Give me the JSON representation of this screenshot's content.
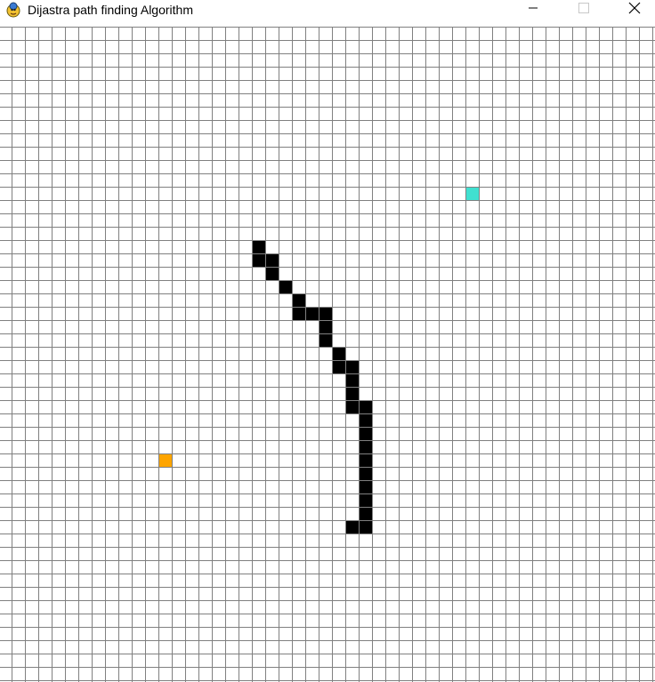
{
  "window": {
    "title": "Dijastra path finding Algorithm",
    "icon": "pygame-snake-icon",
    "controls": [
      "minimize-icon",
      "maximize-icon",
      "close-icon"
    ]
  },
  "grid": {
    "cols": 49,
    "rows": 49,
    "empty_color": "#ffffff",
    "line_color": "#808080",
    "start": {
      "col": 12,
      "row": 32,
      "color": "#ffa500"
    },
    "end": {
      "col": 35,
      "row": 12,
      "color": "#40e0d0"
    },
    "barrier_color": "#000000",
    "barriers": [
      [
        19,
        16
      ],
      [
        19,
        17
      ],
      [
        20,
        17
      ],
      [
        20,
        18
      ],
      [
        21,
        19
      ],
      [
        22,
        20
      ],
      [
        22,
        21
      ],
      [
        23,
        21
      ],
      [
        24,
        21
      ],
      [
        24,
        22
      ],
      [
        24,
        23
      ],
      [
        25,
        24
      ],
      [
        25,
        25
      ],
      [
        26,
        25
      ],
      [
        26,
        26
      ],
      [
        26,
        27
      ],
      [
        26,
        28
      ],
      [
        27,
        28
      ],
      [
        27,
        29
      ],
      [
        27,
        30
      ],
      [
        27,
        31
      ],
      [
        27,
        32
      ],
      [
        27,
        33
      ],
      [
        27,
        34
      ],
      [
        27,
        35
      ],
      [
        27,
        36
      ],
      [
        26,
        37
      ],
      [
        27,
        37
      ]
    ]
  }
}
